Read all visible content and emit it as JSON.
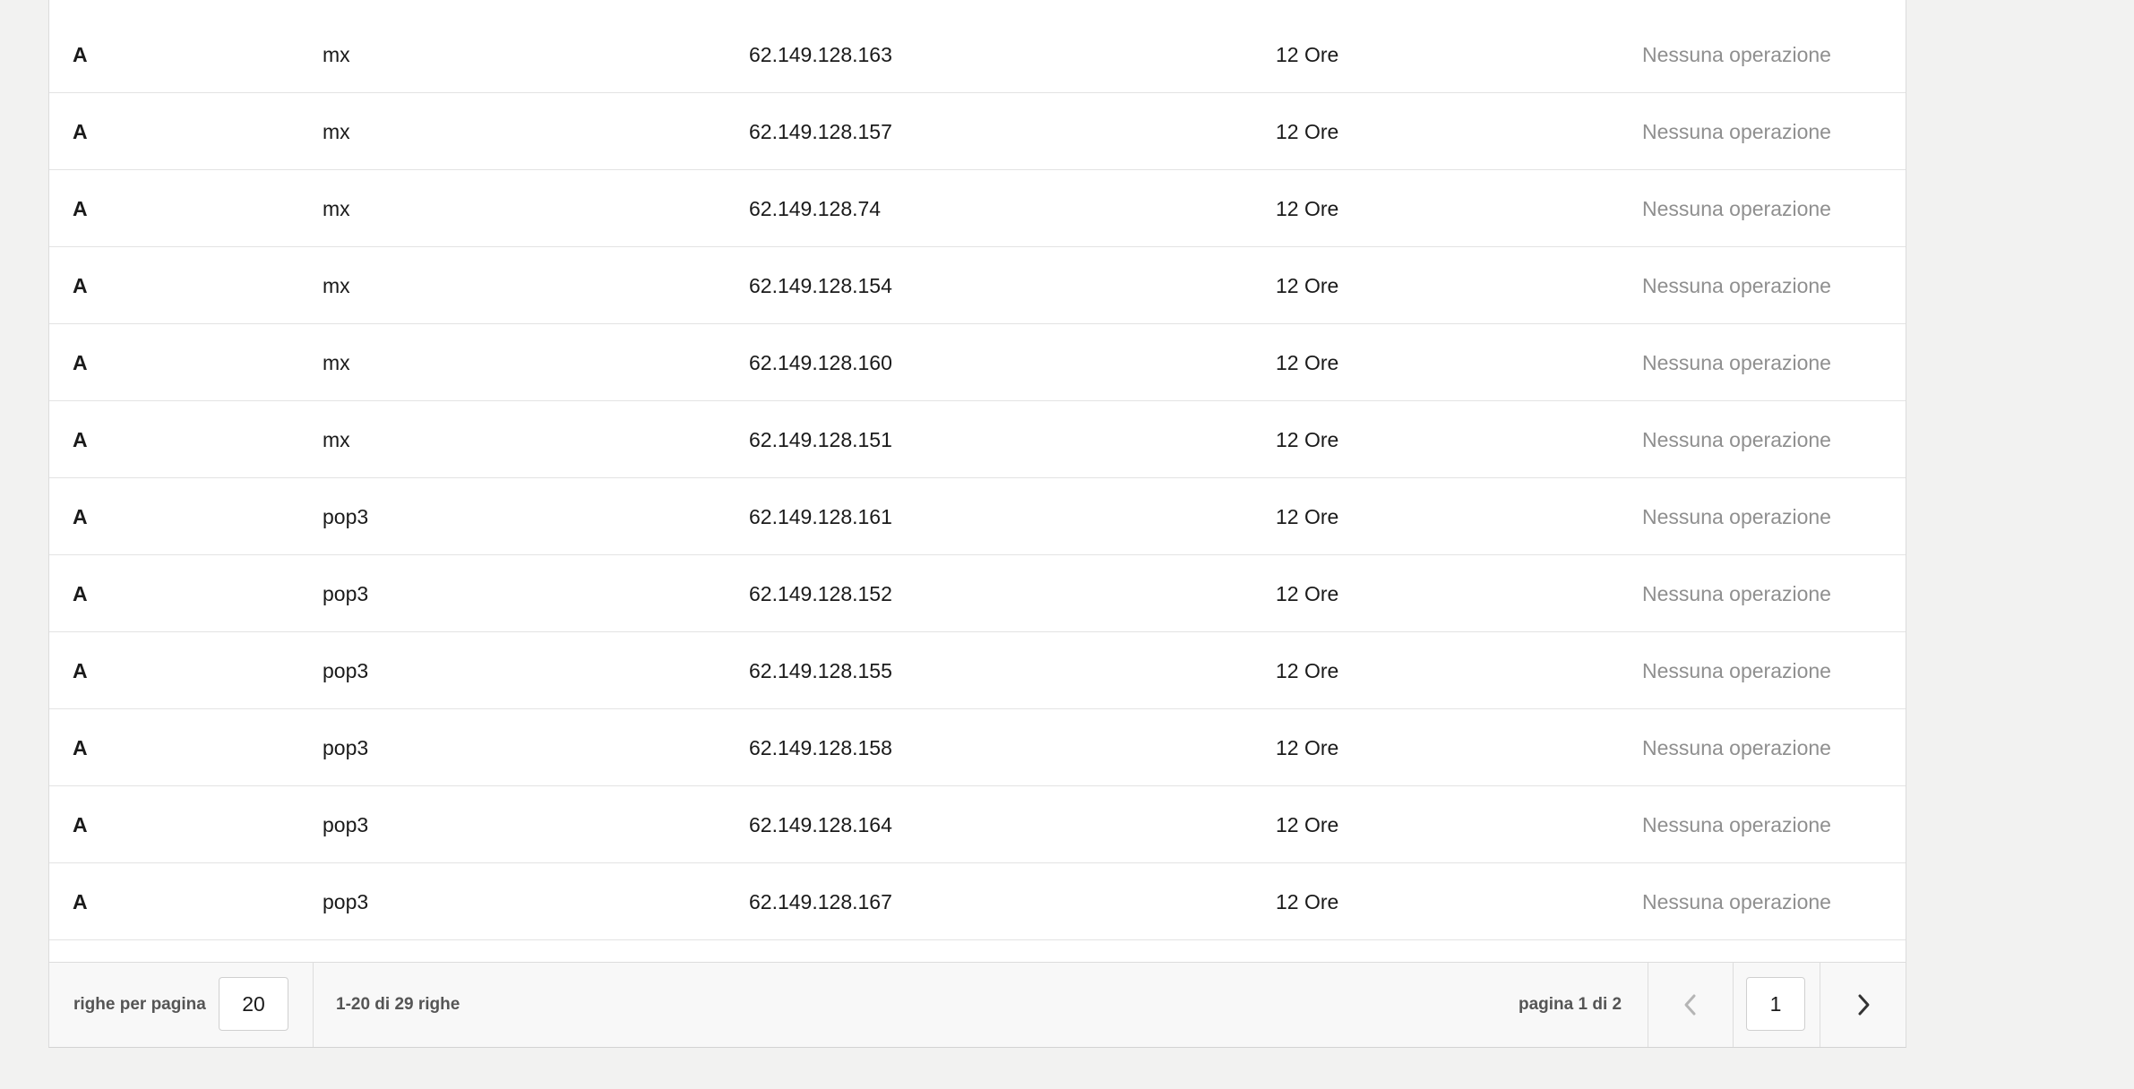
{
  "records": [
    {
      "type": "A",
      "name": "mx",
      "value": "62.149.128.163",
      "ttl": "12 Ore",
      "ops": "Nessuna operazione"
    },
    {
      "type": "A",
      "name": "mx",
      "value": "62.149.128.157",
      "ttl": "12 Ore",
      "ops": "Nessuna operazione"
    },
    {
      "type": "A",
      "name": "mx",
      "value": "62.149.128.74",
      "ttl": "12 Ore",
      "ops": "Nessuna operazione"
    },
    {
      "type": "A",
      "name": "mx",
      "value": "62.149.128.154",
      "ttl": "12 Ore",
      "ops": "Nessuna operazione"
    },
    {
      "type": "A",
      "name": "mx",
      "value": "62.149.128.160",
      "ttl": "12 Ore",
      "ops": "Nessuna operazione"
    },
    {
      "type": "A",
      "name": "mx",
      "value": "62.149.128.151",
      "ttl": "12 Ore",
      "ops": "Nessuna operazione"
    },
    {
      "type": "A",
      "name": "pop3",
      "value": "62.149.128.161",
      "ttl": "12 Ore",
      "ops": "Nessuna operazione"
    },
    {
      "type": "A",
      "name": "pop3",
      "value": "62.149.128.152",
      "ttl": "12 Ore",
      "ops": "Nessuna operazione"
    },
    {
      "type": "A",
      "name": "pop3",
      "value": "62.149.128.155",
      "ttl": "12 Ore",
      "ops": "Nessuna operazione"
    },
    {
      "type": "A",
      "name": "pop3",
      "value": "62.149.128.158",
      "ttl": "12 Ore",
      "ops": "Nessuna operazione"
    },
    {
      "type": "A",
      "name": "pop3",
      "value": "62.149.128.164",
      "ttl": "12 Ore",
      "ops": "Nessuna operazione"
    },
    {
      "type": "A",
      "name": "pop3",
      "value": "62.149.128.167",
      "ttl": "12 Ore",
      "ops": "Nessuna operazione"
    }
  ],
  "pagination": {
    "rows_per_page_label": "righe per pagina",
    "rows_per_page_value": "20",
    "range_text": "1-20 di 29 righe",
    "page_text": "pagina 1 di 2",
    "current_page": "1",
    "prev_icon": "chevron-left-icon",
    "next_icon": "chevron-right-icon"
  },
  "colors": {
    "page_bg": "#f2f2f1",
    "panel_bg": "#ffffff",
    "muted_text": "#8f8f8f",
    "footer_bg": "#f8f8f8",
    "prev_disabled": "#b5b5b5",
    "next_active": "#333333"
  }
}
